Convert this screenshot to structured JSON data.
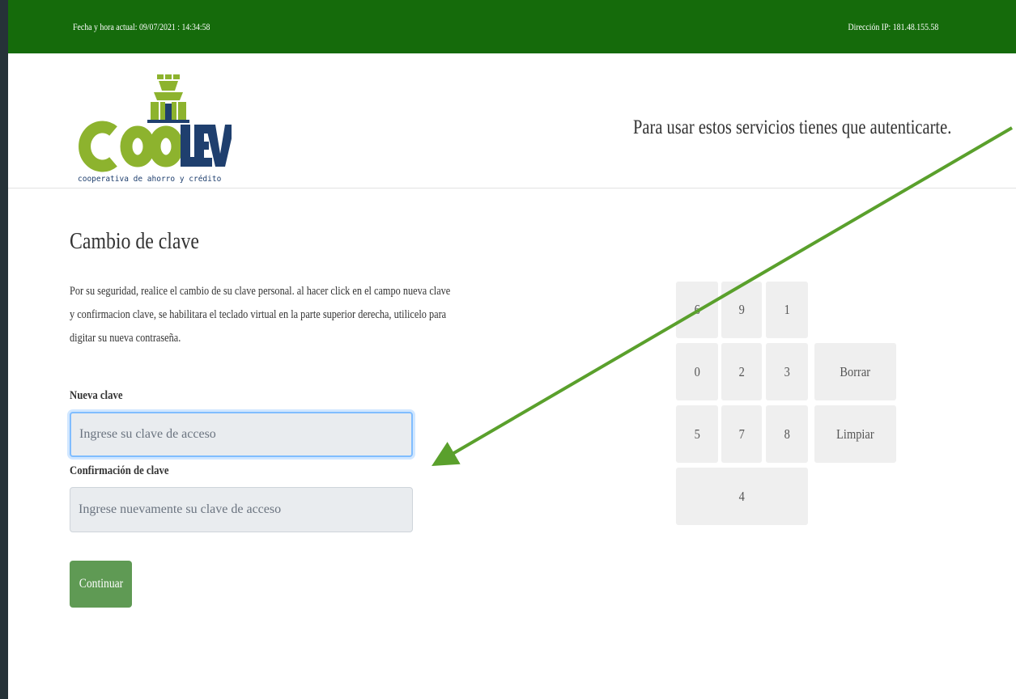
{
  "topbar": {
    "datetime": "Fecha y hora actual: 09/07/2021 : 14:34:58",
    "ip": "Dirección IP: 181.48.155.58"
  },
  "header": {
    "logo_text": "COOLEVER",
    "logo_subtitle": "cooperativa de ahorro y crédito",
    "tagline": "Para usar estos servicios tienes que autenticarte."
  },
  "form": {
    "title": "Cambio de clave",
    "description_lines": [
      "Por su seguridad, realice el cambio de su clave personal. al hacer click en el campo nueva clave",
      "y confirmacion clave, se habilitara el teclado virtual en la parte superior derecha, utilicelo para",
      "digitar su nueva contraseña."
    ],
    "new_password_label": "Nueva clave",
    "new_password_placeholder": "Ingrese su clave de acceso",
    "confirm_label": "Confirmación de clave",
    "confirm_placeholder": "Ingrese nuevamente su clave de acceso",
    "continue_label": "Continuar"
  },
  "keypad": {
    "row1": [
      "6",
      "9",
      "1"
    ],
    "row2": [
      "0",
      "2",
      "3"
    ],
    "row3": [
      "5",
      "7",
      "8"
    ],
    "row4": [
      "4"
    ],
    "delete_label": "Borrar",
    "clear_label": "Limpiar"
  },
  "colors": {
    "topbar": "#156b0b",
    "logo_green": "#8db32e",
    "logo_dark": "#1f3f6e",
    "button": "#5f9a54",
    "annotation_arrow": "#5aa02c"
  }
}
